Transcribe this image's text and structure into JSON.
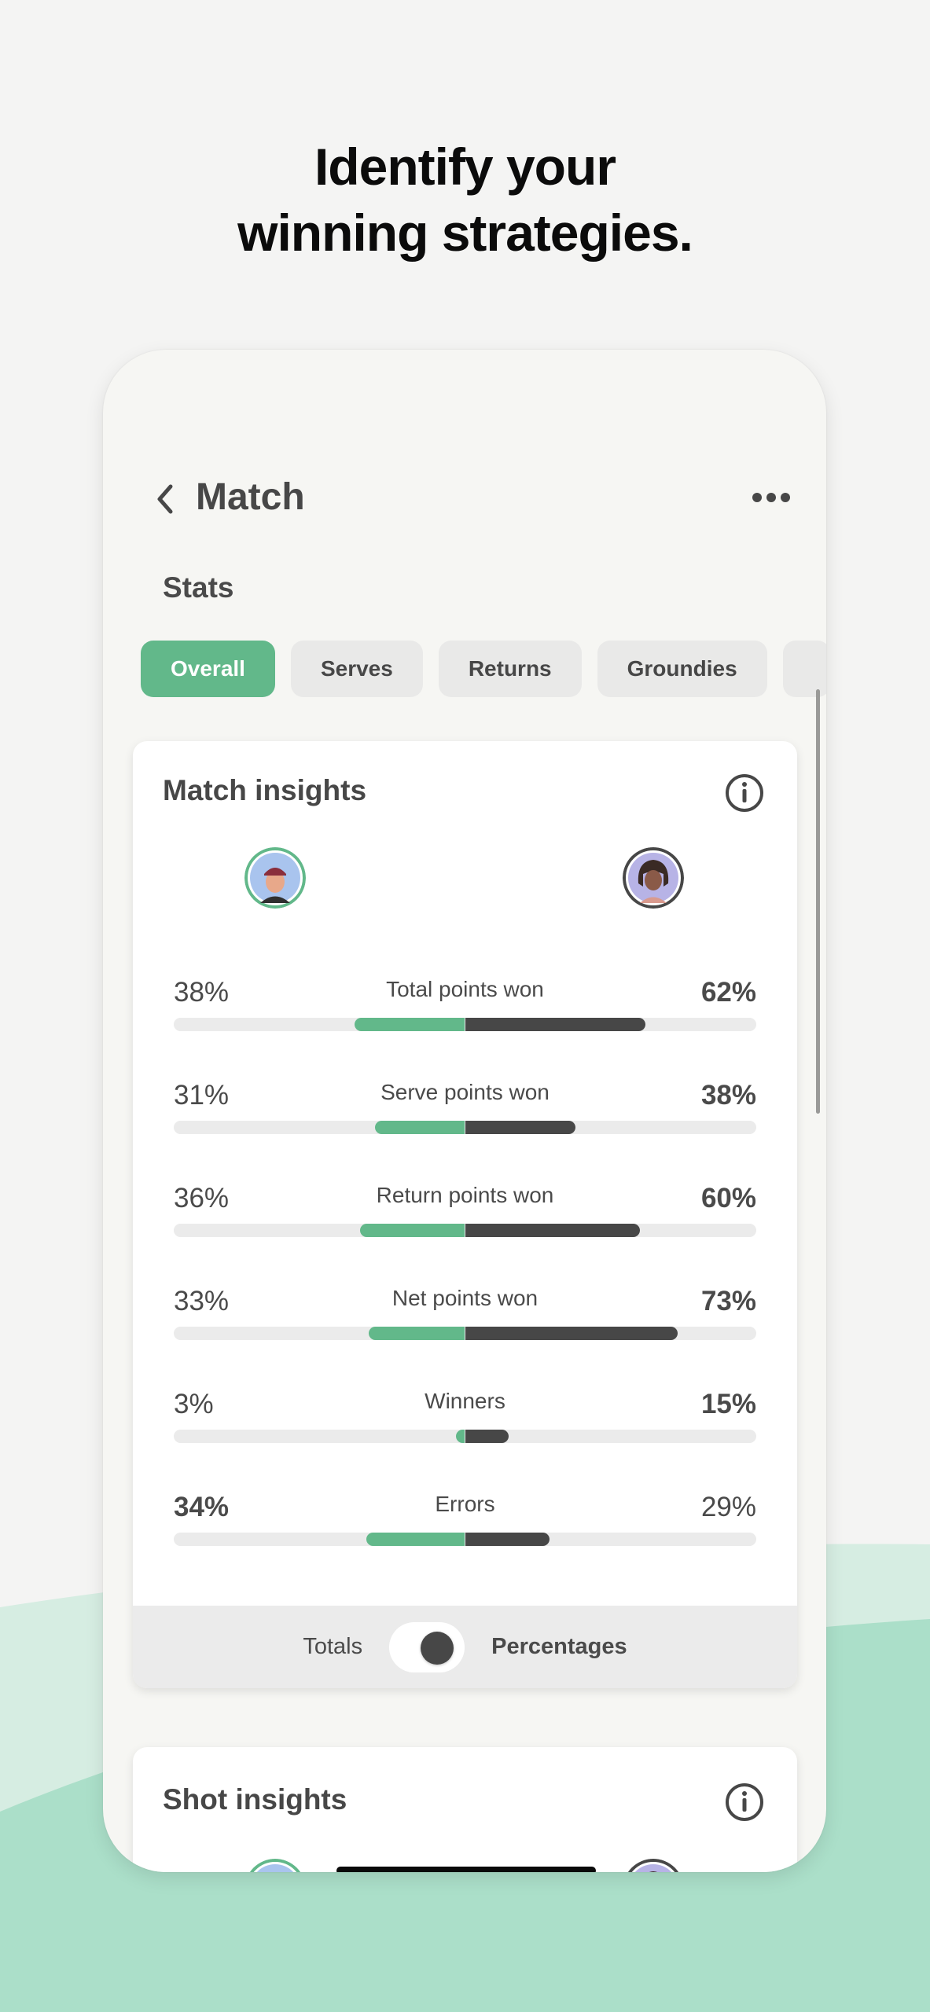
{
  "headline": {
    "line1": "Identify your",
    "line2": "winning strategies."
  },
  "colors": {
    "accent_green": "#62b88a",
    "dark": "#474747",
    "track": "#ebebeb",
    "wave_light": "#d6ede2",
    "wave_dark": "#abdfc9"
  },
  "header": {
    "back_icon": "chevron-left-icon",
    "title": "Match",
    "more_icon": "more-horizontal-icon"
  },
  "section_label": "Stats",
  "tabs": [
    {
      "label": "Overall",
      "active": true
    },
    {
      "label": "Serves",
      "active": false
    },
    {
      "label": "Returns",
      "active": false
    },
    {
      "label": "Groundies",
      "active": false
    },
    {
      "label": "",
      "active": false
    }
  ],
  "match_insights": {
    "title": "Match insights",
    "info_icon": "info-circle-icon",
    "players": [
      {
        "side": "left",
        "ring_color": "#62b88a"
      },
      {
        "side": "right",
        "ring_color": "#474747"
      }
    ],
    "stats": [
      {
        "label": "Total points won",
        "left": "38%",
        "right": "62%",
        "left_value": 38,
        "right_value": 62,
        "bold": "right"
      },
      {
        "label": "Serve points won",
        "left": "31%",
        "right": "38%",
        "left_value": 31,
        "right_value": 38,
        "bold": "right"
      },
      {
        "label": "Return points won",
        "left": "36%",
        "right": "60%",
        "left_value": 36,
        "right_value": 60,
        "bold": "right"
      },
      {
        "label": "Net points won",
        "left": "33%",
        "right": "73%",
        "left_value": 33,
        "right_value": 73,
        "bold": "right"
      },
      {
        "label": "Winners",
        "left": "3%",
        "right": "15%",
        "left_value": 3,
        "right_value": 15,
        "bold": "right"
      },
      {
        "label": "Errors",
        "left": "34%",
        "right": "29%",
        "left_value": 34,
        "right_value": 29,
        "bold": "left"
      }
    ],
    "toggle": {
      "left_label": "Totals",
      "right_label": "Percentages",
      "selected": "Percentages"
    }
  },
  "shot_insights": {
    "title": "Shot insights",
    "info_icon": "info-circle-icon"
  }
}
